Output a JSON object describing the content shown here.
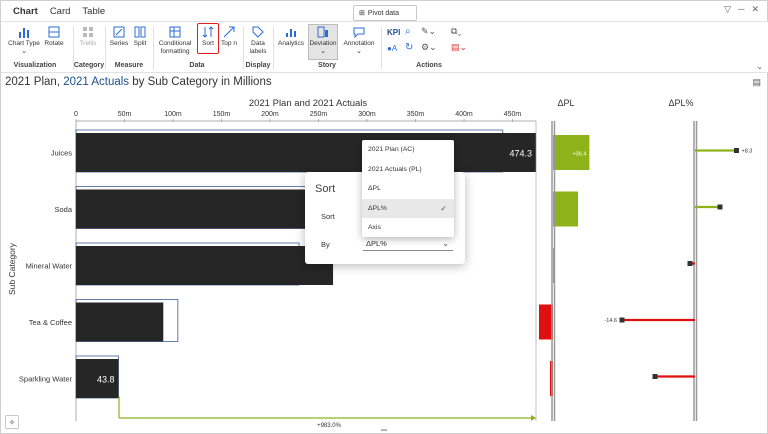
{
  "tabs": [
    "Chart",
    "Card",
    "Table"
  ],
  "pivot_label": "Pivot data",
  "ribbon": {
    "buttons": {
      "chart_type": "Chart Type",
      "rotate": "Rotate",
      "trellis": "Trellis",
      "series": "Series",
      "split": "Split",
      "conditional_1": "Conditional",
      "conditional_2": "formatting",
      "sort": "Sort",
      "top_n": "Top n",
      "data_1": "Data",
      "data_2": "labels",
      "analytics": "Analytics",
      "deviation": "Deviation",
      "annotation": "Annotation",
      "kpi": "KPI"
    },
    "groups": [
      "Visualization",
      "Category",
      "Measure",
      "Data",
      "Display",
      "Story",
      "Actions"
    ]
  },
  "title": {
    "part1": "2021 Plan, ",
    "part2": "2021 Actuals",
    "part3": " by Sub Category in Millions"
  },
  "sort_panel": {
    "title": "Sort",
    "sort_label": "Sort",
    "by_label": "By",
    "by_value": "ΔPL%"
  },
  "dropdown": {
    "options": [
      "2021 Plan (AC)",
      "2021 Actuals (PL)",
      "ΔPL",
      "ΔPL%",
      "Axis"
    ],
    "selected_index": 3
  },
  "chart_data": {
    "type": "bar",
    "title": "2021 Plan and 2021 Actuals",
    "ylabel": "Sub Category",
    "x_ticks": [
      "0",
      "50m",
      "100m",
      "150m",
      "200m",
      "250m",
      "300m",
      "350m",
      "400m",
      "450m"
    ],
    "categories": [
      "Juices",
      "Soda",
      "Mineral Water",
      "Tea & Coffee",
      "Sparkling Water"
    ],
    "series": [
      {
        "name": "2021 Actuals",
        "values": [
          474.3,
          265,
          265,
          90,
          43.8
        ]
      },
      {
        "name": "2021 Plan",
        "values": [
          440,
          240,
          230,
          105,
          43.8
        ]
      }
    ],
    "data_labels": [
      "474.3",
      "",
      "",
      "",
      "43.8"
    ],
    "total_variance_label": "+983.0%",
    "delta_pl": {
      "title": "ΔPL",
      "values": [
        36.4,
        25,
        2,
        -14,
        -3
      ],
      "labels": [
        "+36.4",
        "",
        "",
        "",
        ""
      ]
    },
    "delta_pl_pct": {
      "title": "ΔPL%",
      "values": [
        8.3,
        5,
        -1,
        -14.6,
        -8
      ],
      "labels": [
        "+8.3",
        "",
        "",
        "-14.6",
        ""
      ]
    }
  }
}
